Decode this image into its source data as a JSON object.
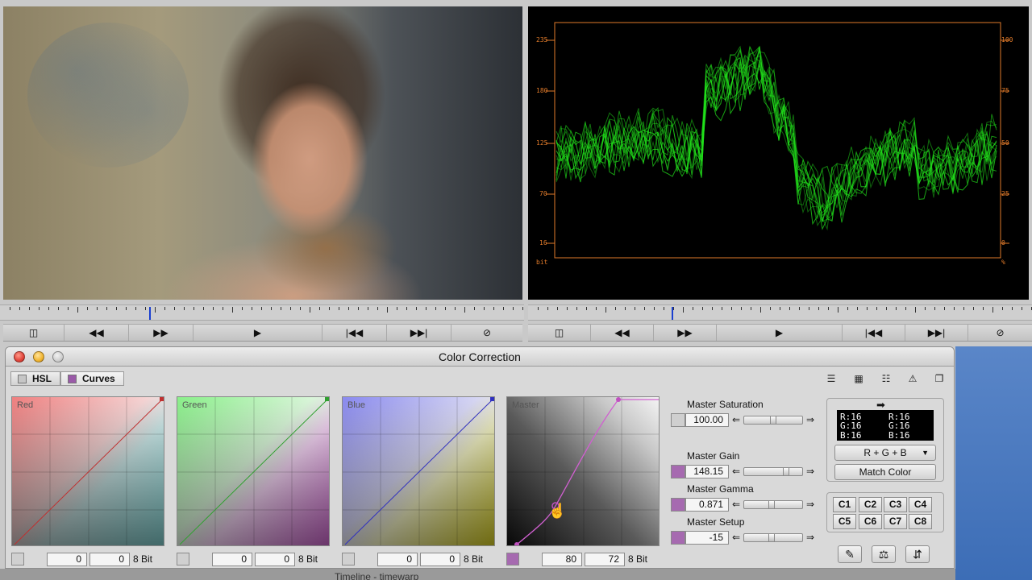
{
  "window": {
    "title": "Color Correction"
  },
  "tabs": [
    {
      "label": "HSL"
    },
    {
      "label": "Curves"
    }
  ],
  "toolbar_icons": [
    "sliders-icon",
    "color-swatch-icon",
    "levels-icon",
    "warning-icon",
    "window-icon"
  ],
  "curves": [
    {
      "name": "Red",
      "in": "0",
      "out": "0",
      "bit": "8 Bit"
    },
    {
      "name": "Green",
      "in": "0",
      "out": "0",
      "bit": "8 Bit"
    },
    {
      "name": "Blue",
      "in": "0",
      "out": "0",
      "bit": "8 Bit"
    },
    {
      "name": "Master",
      "in": "80",
      "out": "72",
      "bit": "8 Bit"
    }
  ],
  "master_controls": [
    {
      "label": "Master Saturation",
      "value": "100.00"
    },
    {
      "label": "Master Gain",
      "value": "148.15"
    },
    {
      "label": "Master Gamma",
      "value": "0.871"
    },
    {
      "label": "Master Setup",
      "value": "-15"
    }
  ],
  "match": {
    "arrow": "➡",
    "readout_left": [
      "R:16",
      "G:16",
      "B:16"
    ],
    "readout_right": [
      "R:16",
      "G:16",
      "B:16"
    ],
    "channel_select": "R + G + B",
    "match_button": "Match Color"
  },
  "color_buttons": [
    "C1",
    "C2",
    "C3",
    "C4",
    "C5",
    "C6",
    "C7",
    "C8"
  ],
  "waveform": {
    "left_scale": [
      "235",
      "180",
      "125",
      "70",
      "16"
    ],
    "left_unit": "bit",
    "right_scale": [
      "100",
      "75",
      "50",
      "25",
      "0"
    ],
    "right_unit": "%"
  },
  "bottom_label": "Timeline - timewarp"
}
